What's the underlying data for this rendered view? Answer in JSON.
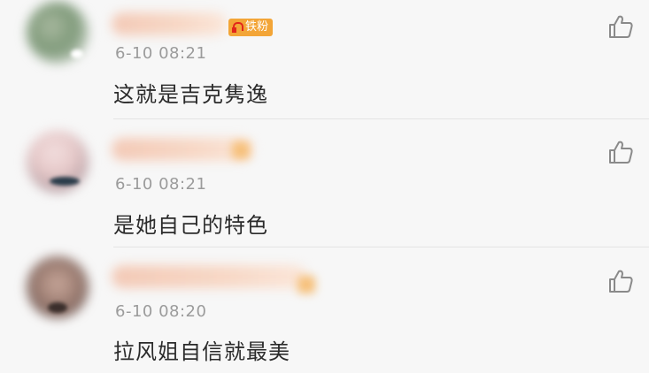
{
  "comments": [
    {
      "badge": "铁粉",
      "time": "6-10 08:21",
      "text": "这就是吉克隽逸",
      "like_icon": "thumbs-up-icon"
    },
    {
      "time": "6-10 08:21",
      "text": "是她自己的特色",
      "like_icon": "thumbs-up-icon"
    },
    {
      "time": "6-10 08:20",
      "text": "拉风姐自信就最美",
      "like_icon": "thumbs-up-icon"
    }
  ],
  "colors": {
    "background": "#f7f7f7",
    "badge": "#f3a537",
    "time": "#9b9b9b",
    "text": "#2b2b2b",
    "divider": "#e4e4e4"
  }
}
